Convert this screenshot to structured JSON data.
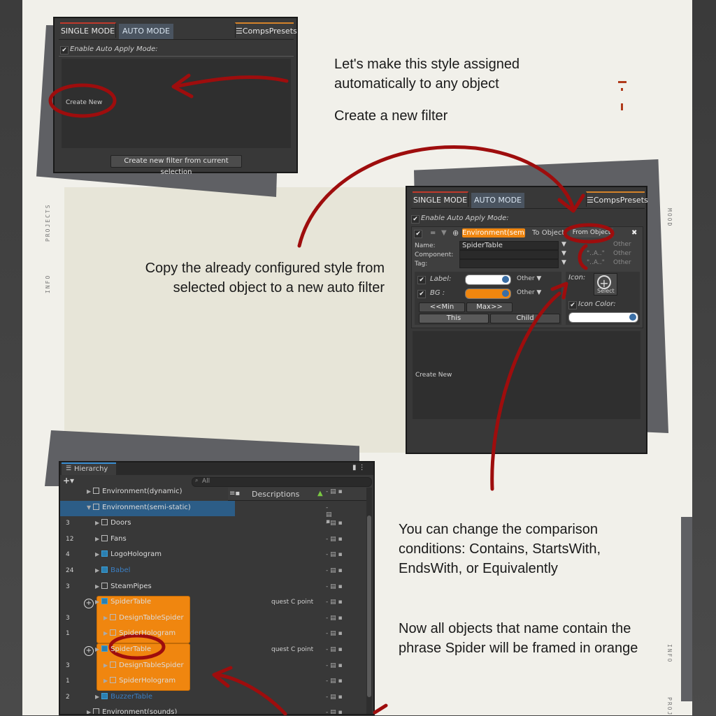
{
  "side_labels": {
    "projects": "PROJECTS",
    "info": "INFO",
    "mood": "MOOD",
    "info2": "INFO",
    "projects2": "PROJ"
  },
  "notes": {
    "note1": "Let's make this style assigned automatically to any object",
    "note2": "Create a new filter",
    "note3": "Copy the already configured style from selected object to a new auto filter",
    "note4": "You can change the comparison conditions: Contains, StartsWith, EndsWith, or Equivalently",
    "note5": "Now all objects that name contain the phrase Spider will be framed in orange"
  },
  "panel1": {
    "tab_single": "SINGLE MODE",
    "tab_auto": "AUTO MODE",
    "tab_presets": "☰CompsPresets",
    "auto_apply": "Enable Auto Apply Mode:",
    "check": "✔",
    "create_new": "Create New",
    "create_from_selection": "Create new filter from current selection"
  },
  "panel2": {
    "tab_single": "SINGLE MODE",
    "tab_auto": "AUTO MODE",
    "tab_presets": "☰CompsPresets",
    "auto_apply": "Enable Auto Apply Mode:",
    "check": "✔",
    "filter_eq": "=",
    "filter_plus": "⊕",
    "filter_name": "Environment(semi-",
    "to_object": "To Object",
    "from_object": "From Object",
    "close": "✖",
    "name_label": "Name:",
    "name_value": "SpiderTable",
    "component_label": "Component:",
    "tag_label": "Tag:",
    "name_mode": "\"\"",
    "comp_mode": "\"..A..\"",
    "tag_mode": "\"..A..\"",
    "other": "Other",
    "other2": "Other",
    "other3": "Other",
    "label_label": "Label:",
    "bg_label": "BG  :",
    "label_other": "Other ▼",
    "bg_other": "Other ▼",
    "min": "<<Min",
    "max": "Max>>",
    "this": "This",
    "child": "Child",
    "icon_label": "Icon:",
    "icon_select": "Select",
    "icon_color": "Icon Color:",
    "create_new": "Create New",
    "colors": {
      "label": "#ffffff",
      "bg": "#f0860f"
    }
  },
  "hierarchy": {
    "tab": "Hierarchy",
    "plus": "+▾",
    "search_placeholder": "All",
    "descriptions": "Descriptions",
    "rows": [
      {
        "count": "",
        "name": "Environment(dynamic)",
        "desc": ""
      },
      {
        "count": "",
        "name": "Environment(semi-static)",
        "desc": ""
      },
      {
        "count": "3",
        "name": "Doors",
        "desc": ""
      },
      {
        "count": "12",
        "name": "Fans",
        "desc": ""
      },
      {
        "count": "4",
        "name": "LogoHologram",
        "desc": ""
      },
      {
        "count": "24",
        "name": "Babel",
        "desc": ""
      },
      {
        "count": "3",
        "name": "SteamPipes",
        "desc": ""
      },
      {
        "count": "",
        "name": "SpiderTable",
        "desc": "quest C point"
      },
      {
        "count": "3",
        "name": "DesignTableSpider",
        "desc": ""
      },
      {
        "count": "1",
        "name": "SpiderHologram",
        "desc": ""
      },
      {
        "count": "",
        "name": "SpiderTable",
        "desc": "quest C point"
      },
      {
        "count": "3",
        "name": "DesignTableSpider",
        "desc": ""
      },
      {
        "count": "1",
        "name": "SpiderHologram",
        "desc": ""
      },
      {
        "count": "2",
        "name": "BuzzerTable",
        "desc": ""
      },
      {
        "count": "",
        "name": "Environment(sounds)",
        "desc": ""
      }
    ]
  },
  "colors": {
    "paper": "#f1f0ea",
    "accent_red": "#9e0d0d",
    "orange": "#f0860f",
    "selected_row": "#2c5d87"
  }
}
